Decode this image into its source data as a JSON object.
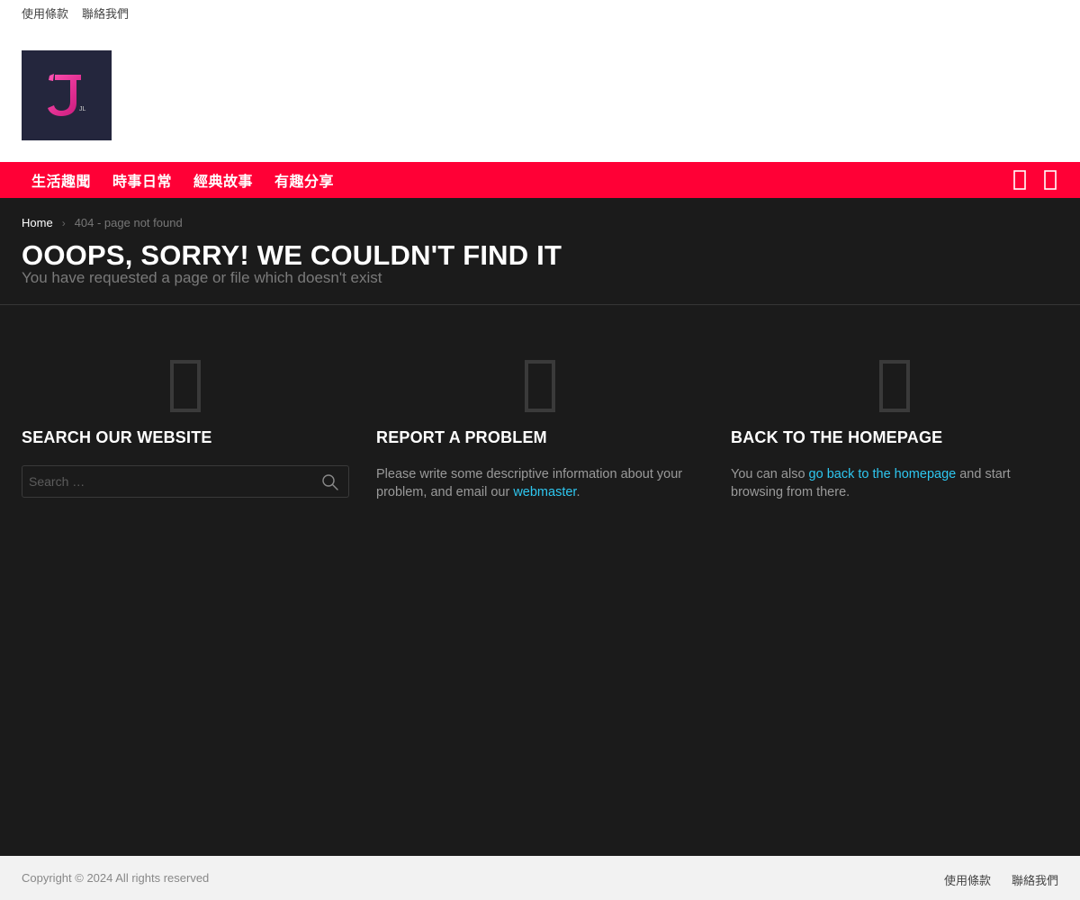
{
  "top_bar": {
    "links": [
      {
        "label": "使用條款"
      },
      {
        "label": "聯絡我們"
      }
    ]
  },
  "logo": {
    "letter": "J",
    "small_text": "JL",
    "bg_color": "#24263d",
    "accent_color": "#e8349a"
  },
  "nav": {
    "bg_color": "#ff0036",
    "items": [
      {
        "label": "生活趣聞"
      },
      {
        "label": "時事日常"
      },
      {
        "label": "經典故事"
      },
      {
        "label": "有趣分享"
      }
    ],
    "actions": [
      {
        "icon": "search-icon"
      },
      {
        "icon": "menu-icon"
      }
    ]
  },
  "breadcrumb": {
    "home": "Home",
    "separator": "›",
    "current": "404 - page not found"
  },
  "page": {
    "title": "OOOPS, SORRY! WE COULDN'T FIND IT",
    "subtitle": "You have requested a page or file which doesn't exist"
  },
  "columns": {
    "search": {
      "icon": "search-icon",
      "heading": "Search our website",
      "placeholder": "Search …",
      "value": ""
    },
    "report": {
      "icon": "warning-icon",
      "heading": "Report a problem",
      "text_before": "Please write some descriptive information about your problem, and email our ",
      "link": "webmaster",
      "text_after": "."
    },
    "home": {
      "icon": "home-icon",
      "heading": "Back to the homepage",
      "text_before": "You can also ",
      "link": "go back to the homepage",
      "text_after": " and start browsing from there."
    }
  },
  "footer": {
    "copyright": "Copyright © 2024 All rights reserved",
    "links": [
      {
        "label": "使用條款"
      },
      {
        "label": "聯絡我們"
      }
    ]
  },
  "colors": {
    "link": "#2ec7f0",
    "page_bg": "#1b1b1b",
    "footer_bg": "#f2f2f2"
  }
}
